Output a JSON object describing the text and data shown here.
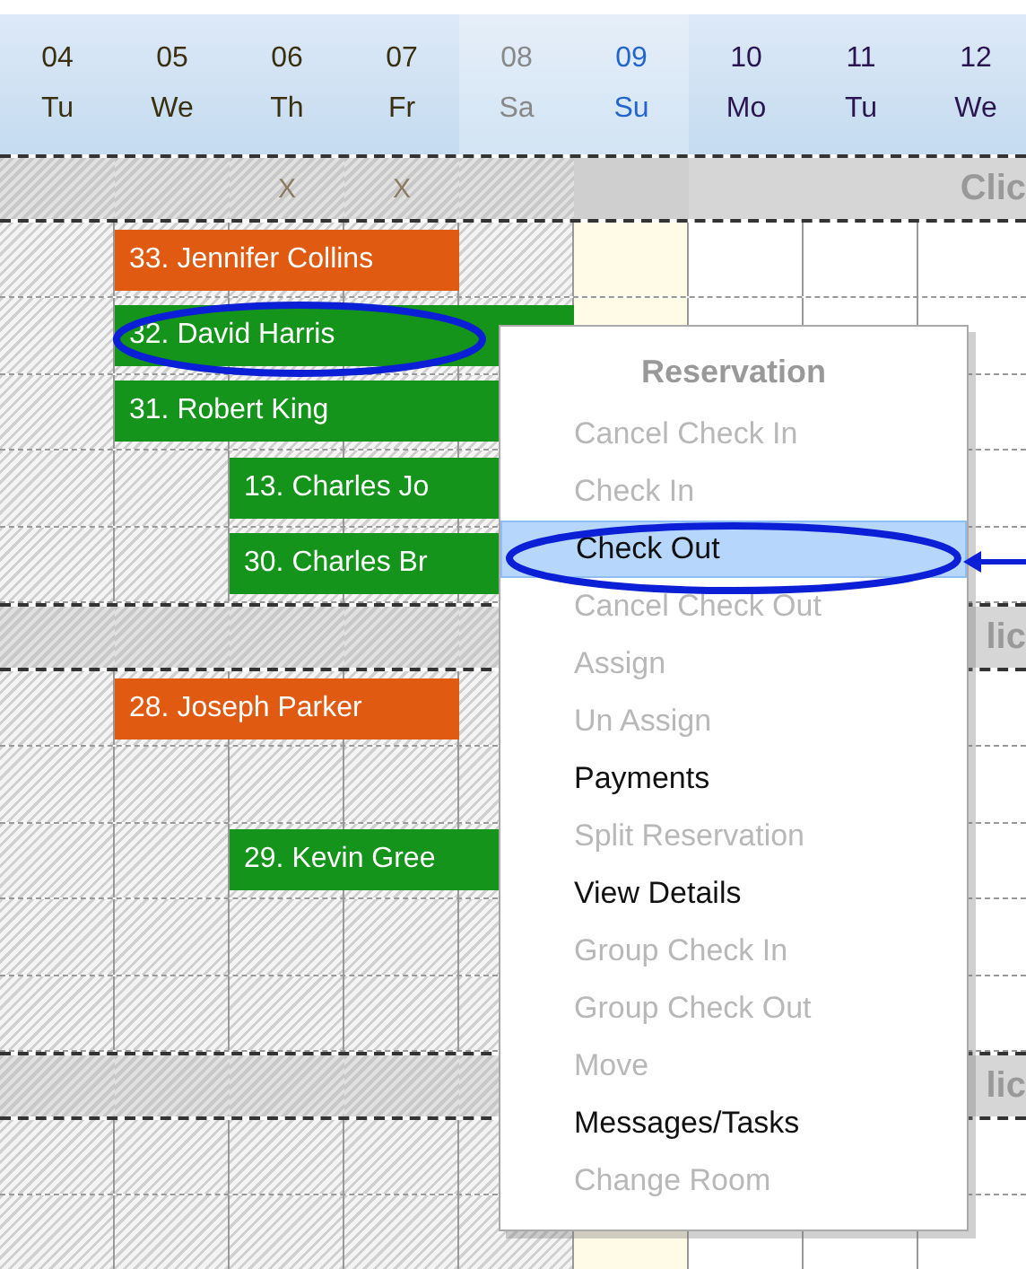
{
  "days": [
    {
      "date": "04",
      "weekday": "Tu",
      "past": true,
      "today": false,
      "weekend": false
    },
    {
      "date": "05",
      "weekday": "We",
      "past": true,
      "today": false,
      "weekend": false
    },
    {
      "date": "06",
      "weekday": "Th",
      "past": true,
      "today": false,
      "weekend": false
    },
    {
      "date": "07",
      "weekday": "Fr",
      "past": true,
      "today": false,
      "weekend": false
    },
    {
      "date": "08",
      "weekday": "Sa",
      "past": true,
      "today": false,
      "weekend": true
    },
    {
      "date": "09",
      "weekday": "Su",
      "past": false,
      "today": true,
      "weekend": true
    },
    {
      "date": "10",
      "weekday": "Mo",
      "past": false,
      "today": false,
      "weekend": false
    },
    {
      "date": "11",
      "weekday": "Tu",
      "past": false,
      "today": false,
      "weekend": false
    },
    {
      "date": "12",
      "weekday": "We",
      "past": false,
      "today": false,
      "weekend": false
    }
  ],
  "groups": [
    {
      "label": "Clic",
      "marks": [
        "X",
        "X"
      ],
      "rows": [
        {
          "booking": {
            "label": "33. Jennifer Collins",
            "color": "#e05a12"
          }
        },
        {
          "booking": {
            "label": "32. David Harris",
            "color": "#14941a"
          }
        },
        {
          "booking": {
            "label": "31. Robert King",
            "color": "#14941a"
          }
        },
        {
          "booking": {
            "label": "13. Charles Jo",
            "color": "#14941a"
          }
        },
        {
          "booking": {
            "label": "30. Charles Br",
            "color": "#14941a"
          }
        }
      ]
    },
    {
      "label": "lic",
      "rows": [
        {
          "booking": {
            "label": "28. Joseph Parker",
            "color": "#e05a12"
          }
        },
        {
          "booking": null
        },
        {
          "booking": {
            "label": "29. Kevin Gree",
            "color": "#14941a"
          }
        },
        {
          "booking": null
        },
        {
          "booking": null
        }
      ]
    },
    {
      "label": "lic",
      "rows": [
        {
          "booking": null
        },
        {
          "booking": null
        }
      ]
    }
  ],
  "context_menu": {
    "title": "Reservation",
    "items": [
      {
        "label": "Cancel Check In",
        "disabled": true,
        "selected": false
      },
      {
        "label": "Check In",
        "disabled": true,
        "selected": false
      },
      {
        "label": "Check Out",
        "disabled": false,
        "selected": true
      },
      {
        "label": "Cancel Check Out",
        "disabled": true,
        "selected": false
      },
      {
        "label": "Assign",
        "disabled": true,
        "selected": false
      },
      {
        "label": "Un Assign",
        "disabled": true,
        "selected": false
      },
      {
        "label": "Payments",
        "disabled": false,
        "selected": false
      },
      {
        "label": "Split Reservation",
        "disabled": true,
        "selected": false
      },
      {
        "label": "View Details",
        "disabled": false,
        "selected": false
      },
      {
        "label": "Group Check In",
        "disabled": true,
        "selected": false
      },
      {
        "label": "Group Check Out",
        "disabled": true,
        "selected": false
      },
      {
        "label": "Move",
        "disabled": true,
        "selected": false
      },
      {
        "label": "Messages/Tasks",
        "disabled": false,
        "selected": false
      },
      {
        "label": "Change Room",
        "disabled": true,
        "selected": false
      }
    ]
  }
}
